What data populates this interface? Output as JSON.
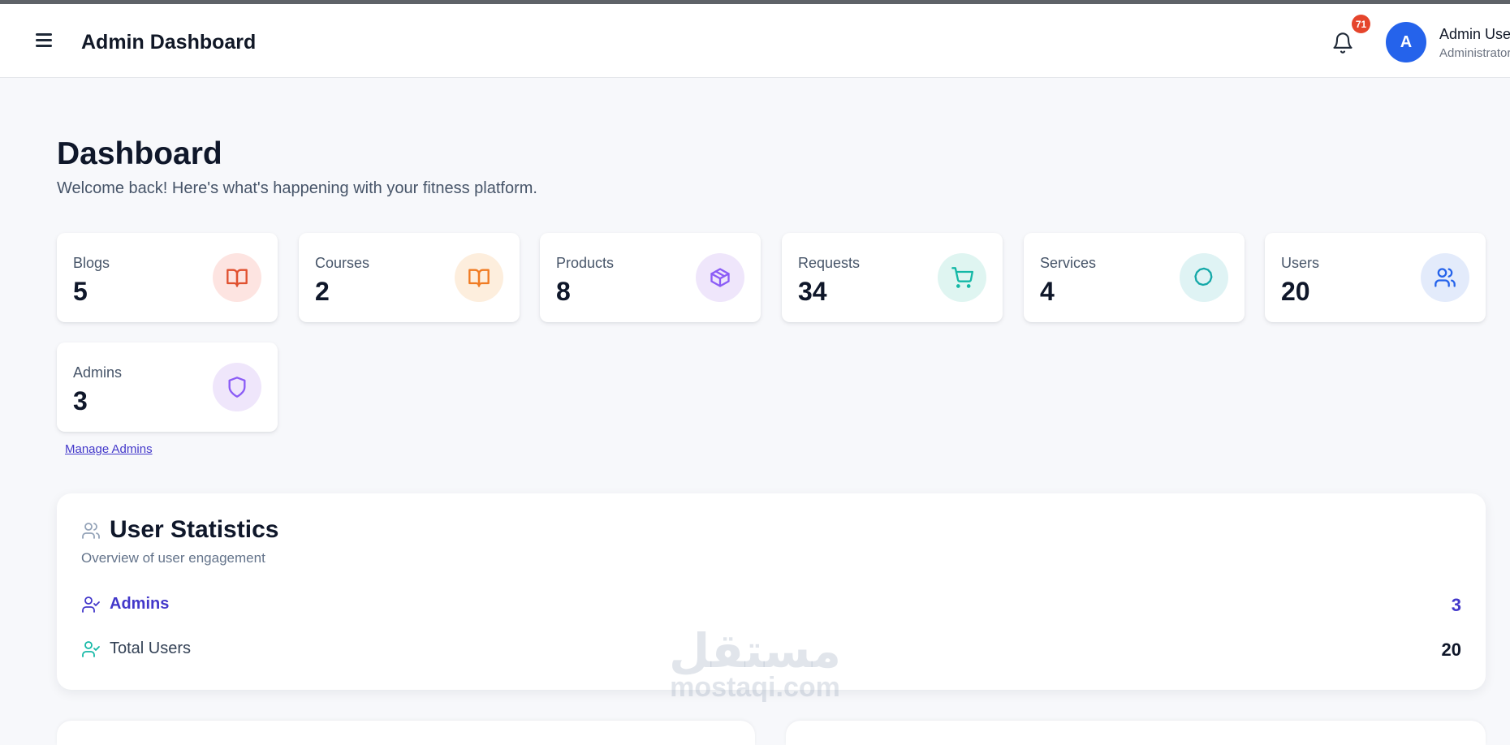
{
  "header": {
    "title": "Admin Dashboard",
    "notification_count": "71",
    "user": {
      "initial": "A",
      "name": "Admin User",
      "role": "Administrator"
    }
  },
  "page": {
    "title": "Dashboard",
    "subtitle": "Welcome back! Here's what's happening with your fitness platform."
  },
  "cards": [
    {
      "label": "Blogs",
      "value": "5",
      "icon": "book-open-icon",
      "icon_color": "#e0502f",
      "icon_bg": "#fde4e1"
    },
    {
      "label": "Courses",
      "value": "2",
      "icon": "book-open-icon",
      "icon_color": "#f07b22",
      "icon_bg": "#fdeedd"
    },
    {
      "label": "Products",
      "value": "8",
      "icon": "package-icon",
      "icon_color": "#8b5cf6",
      "icon_bg": "#efe6fb"
    },
    {
      "label": "Requests",
      "value": "34",
      "icon": "shopping-cart-icon",
      "icon_color": "#14b8a6",
      "icon_bg": "#dff5f1"
    },
    {
      "label": "Services",
      "value": "4",
      "icon": "octagon-icon",
      "icon_color": "#14a8a8",
      "icon_bg": "#dff3f4"
    },
    {
      "label": "Users",
      "value": "20",
      "icon": "users-icon",
      "icon_color": "#2563eb",
      "icon_bg": "#e3ebfb"
    },
    {
      "label": "Admins",
      "value": "3",
      "icon": "shield-icon",
      "icon_color": "#8b5cf6",
      "icon_bg": "#efe6fb"
    }
  ],
  "manage_link": "Manage Admins",
  "stats": {
    "title": "User Statistics",
    "subtitle": "Overview of user engagement",
    "rows": [
      {
        "label": "Admins",
        "value": "3",
        "color": "#4338ca"
      },
      {
        "label": "Total Users",
        "value": "20",
        "color": "#14b8a6"
      }
    ]
  },
  "watermark": {
    "arabic": "مستقل",
    "latin": "mostaqi.com"
  }
}
